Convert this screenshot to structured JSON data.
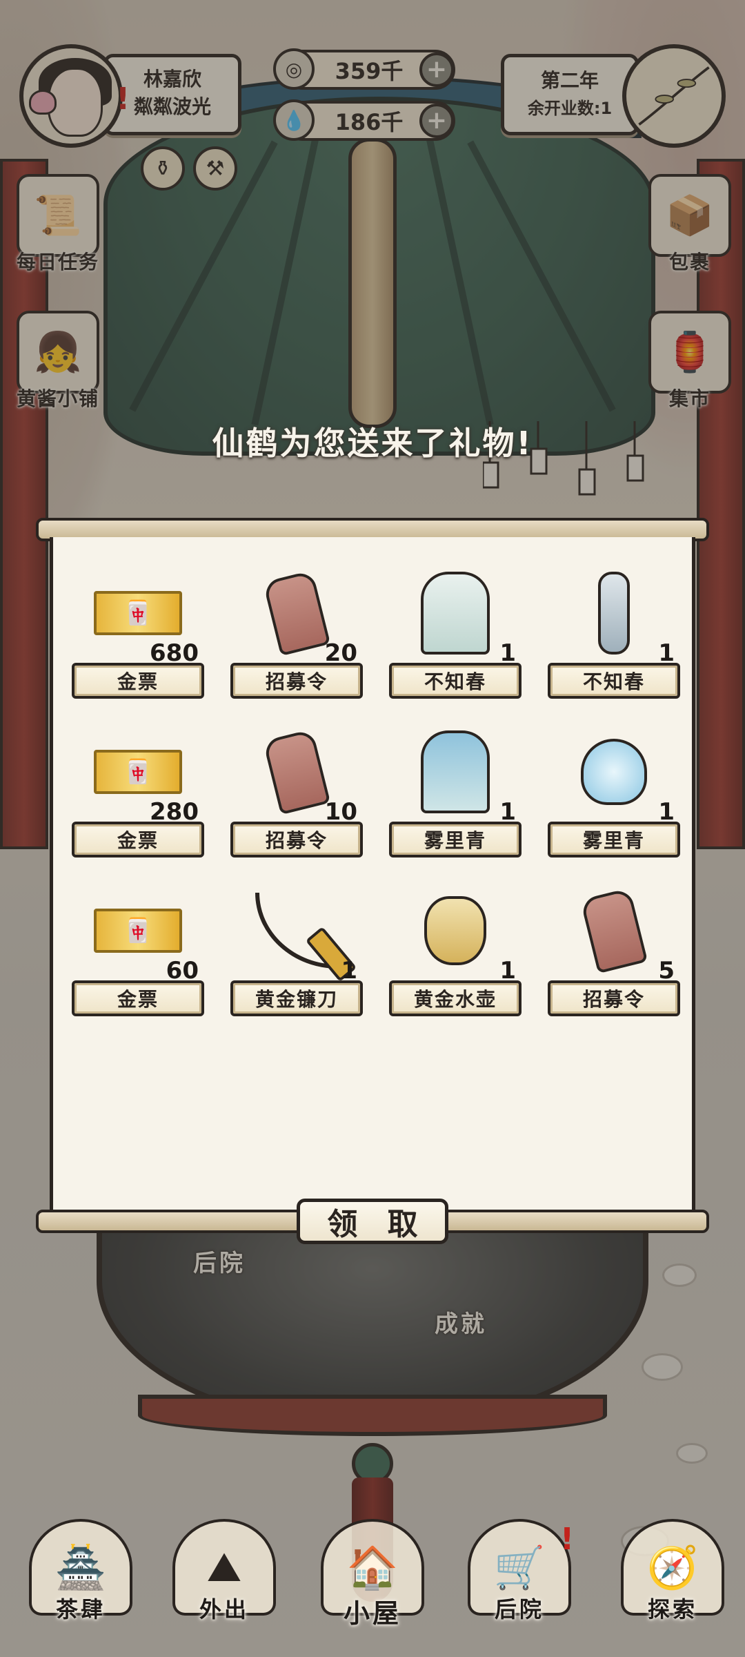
{
  "player": {
    "name": "林嘉欣",
    "title": "粼粼波光",
    "alert": "!"
  },
  "currency": {
    "coins": "359千",
    "water": "186千",
    "plus": "+"
  },
  "season": {
    "year": "第二年",
    "remaining_days": "余开业数:1"
  },
  "side_menu_left": [
    {
      "label": "每日任务",
      "icon": "scroll-icon"
    },
    {
      "label": "黄酱小铺",
      "icon": "shopkeeper-icon"
    }
  ],
  "side_menu_right": [
    {
      "label": "包裹",
      "icon": "package-icon"
    },
    {
      "label": "集市",
      "icon": "market-icon"
    }
  ],
  "map_labels": {
    "backyard": "后院",
    "achievements": "成就"
  },
  "gift": {
    "title": "仙鹤为您送来了礼物!",
    "claim_label": "领 取",
    "items": [
      {
        "name": "金票",
        "qty": "680",
        "icon": "gold-ticket-icon"
      },
      {
        "name": "招募令",
        "qty": "20",
        "icon": "recruit-token-icon"
      },
      {
        "name": "不知春",
        "qty": "1",
        "icon": "robe-icon"
      },
      {
        "name": "不知春",
        "qty": "1",
        "icon": "hairpin-icon"
      },
      {
        "name": "金票",
        "qty": "280",
        "icon": "gold-ticket-icon"
      },
      {
        "name": "招募令",
        "qty": "10",
        "icon": "recruit-token-icon"
      },
      {
        "name": "雾里青",
        "qty": "1",
        "icon": "dress-icon"
      },
      {
        "name": "雾里青",
        "qty": "1",
        "icon": "lantern-ornament-icon"
      },
      {
        "name": "金票",
        "qty": "60",
        "icon": "gold-ticket-icon"
      },
      {
        "name": "黄金镰刀",
        "qty": "1",
        "icon": "sickle-icon"
      },
      {
        "name": "黄金水壶",
        "qty": "1",
        "icon": "teapot-icon"
      },
      {
        "name": "招募令",
        "qty": "5",
        "icon": "recruit-token-icon"
      }
    ]
  },
  "bottom_nav": [
    {
      "label": "茶肆",
      "icon": "teahouse-icon"
    },
    {
      "label": "外出",
      "icon": "outing-icon"
    },
    {
      "label": "小屋",
      "icon": "cottage-icon"
    },
    {
      "label": "后院",
      "icon": "backyard-icon"
    },
    {
      "label": "探索",
      "icon": "explore-icon"
    }
  ],
  "colors": {
    "ink": "#2a2420",
    "paper": "#f7f3ea",
    "alert_red": "#c3221c",
    "roof_green": "#3b5e50",
    "pillar_red": "#9b3a31"
  }
}
